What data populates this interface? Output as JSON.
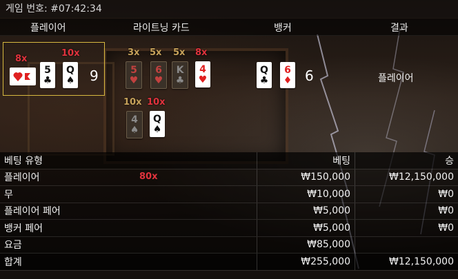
{
  "header": {
    "game_number": "게임 번호: #07:42:34"
  },
  "columns": {
    "player": "플레이어",
    "lightning_cards": "라이트닝 카드",
    "banker": "뱅커",
    "result": "결과"
  },
  "player": {
    "cards": [
      {
        "rank": "",
        "suit": "heart",
        "color": "red",
        "multiplier": "8x",
        "mult_color": "red"
      },
      {
        "rank": "5",
        "suit": "♣",
        "color": "black",
        "multiplier": "",
        "mult_color": ""
      },
      {
        "rank": "Q",
        "suit": "♠",
        "color": "black",
        "multiplier": "10x",
        "mult_color": "red"
      }
    ],
    "score": "9"
  },
  "lightning_cards": [
    {
      "rank": "5",
      "suit": "♥",
      "color": "red",
      "multiplier": "3x",
      "dim": true
    },
    {
      "rank": "6",
      "suit": "♥",
      "color": "red",
      "multiplier": "5x",
      "dim": true
    },
    {
      "rank": "K",
      "suit": "♣",
      "color": "black",
      "multiplier": "5x",
      "dim": true
    },
    {
      "rank": "4",
      "suit": "♥",
      "color": "red",
      "multiplier": "8x",
      "dim": false
    },
    {
      "rank": "4",
      "suit": "♠",
      "color": "black",
      "multiplier": "10x",
      "dim": true
    },
    {
      "rank": "Q",
      "suit": "♠",
      "color": "black",
      "multiplier": "10x",
      "dim": false
    }
  ],
  "banker": {
    "cards": [
      {
        "rank": "Q",
        "suit": "♣",
        "color": "black"
      },
      {
        "rank": "6",
        "suit": "♦",
        "color": "red"
      }
    ],
    "score": "6"
  },
  "result": "플레이어",
  "bets_table": {
    "headers": {
      "type": "베팅 유형",
      "bet": "베팅",
      "win": "승"
    },
    "rows": [
      {
        "type": "플레이어",
        "bet": "₩150,000",
        "win": "₩12,150,000",
        "multiplier": "80x"
      },
      {
        "type": "무",
        "bet": "₩10,000",
        "win": "₩0"
      },
      {
        "type": "플레이어 페어",
        "bet": "₩5,000",
        "win": "₩0"
      },
      {
        "type": "뱅커 페어",
        "bet": "₩5,000",
        "win": "₩0"
      },
      {
        "type": "요금",
        "bet": "₩85,000",
        "win": ""
      }
    ],
    "total": {
      "type": "합계",
      "bet": "₩255,000",
      "win": "₩12,150,000"
    }
  },
  "colors": {
    "multiplier_red": "#e0333d",
    "multiplier_gold": "#c7a25a",
    "player_highlight": "#d7b940"
  }
}
